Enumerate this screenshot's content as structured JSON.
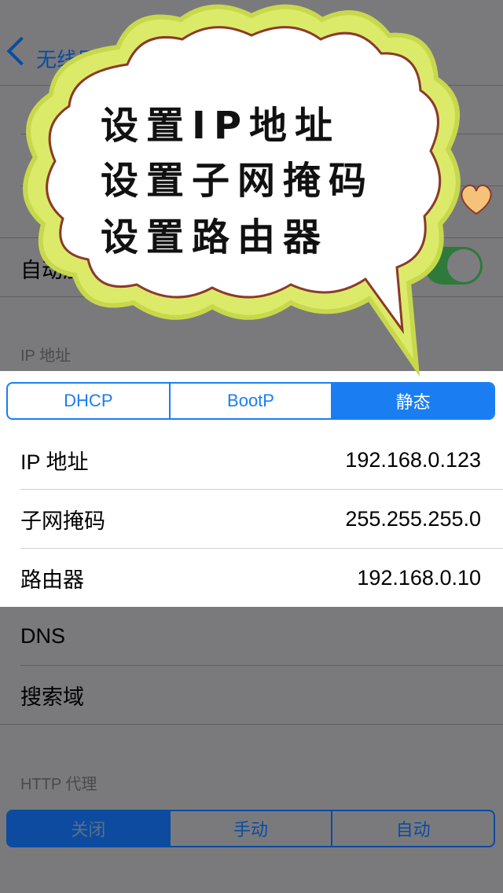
{
  "nav": {
    "back_label": "无线局域网"
  },
  "row_auto_label": "自动加入",
  "ip_section_header": "IP 地址",
  "ip_mode_tabs": [
    {
      "label": "DHCP"
    },
    {
      "label": "BootP"
    },
    {
      "label": "静态",
      "selected": true
    }
  ],
  "static_rows": [
    {
      "label": "IP 地址",
      "value": "192.168.0.123"
    },
    {
      "label": "子网掩码",
      "value": "255.255.255.0"
    },
    {
      "label": "路由器",
      "value": "192.168.0.10"
    }
  ],
  "other_rows": [
    {
      "label": "DNS"
    },
    {
      "label": "搜索域"
    }
  ],
  "proxy_header": "HTTP 代理",
  "proxy_tabs": [
    {
      "label": "关闭",
      "selected": true
    },
    {
      "label": "手动"
    },
    {
      "label": "自动"
    }
  ],
  "callout": {
    "lines": [
      "设置IP地址",
      "设置子网掩码",
      "设置路由器"
    ],
    "fill_color": "#dcea6a",
    "outline_color": "#8b3a2a"
  },
  "colors": {
    "accent": "#1a7ef2",
    "toggle_on": "#4cd964",
    "heart": "#f6c27a"
  }
}
